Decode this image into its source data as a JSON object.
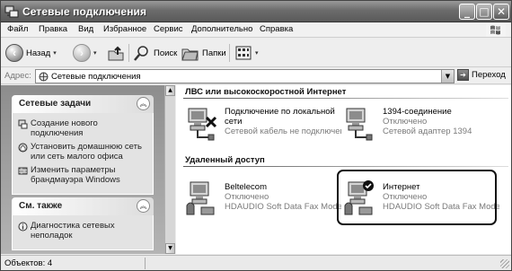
{
  "window": {
    "title": "Сетевые подключения",
    "controls": {
      "minimize": "_",
      "maximize": "□",
      "close": "✕"
    }
  },
  "menu": [
    "Файл",
    "Правка",
    "Вид",
    "Избранное",
    "Сервис",
    "Дополнительно",
    "Справка"
  ],
  "toolbar": {
    "back_label": "Назад",
    "search_label": "Поиск",
    "folders_label": "Папки"
  },
  "address": {
    "label": "Адрес:",
    "value": "Сетевые подключения",
    "go_label": "Переход"
  },
  "left_pane": {
    "network_tasks": {
      "title": "Сетевые задачи",
      "items": [
        "Создание нового подключения",
        "Установить домашнюю сеть или сеть малого офиса",
        "Изменить параметры брандмауэра Windows"
      ]
    },
    "see_also": {
      "title": "См. также",
      "items": [
        "Диагностика сетевых неполадок"
      ]
    }
  },
  "groups": {
    "lan": {
      "title": "ЛВС или высокоскоростной Интернет",
      "items": [
        {
          "name": "Подключение по локальной сети",
          "status": "Сетевой кабель не подключен"
        },
        {
          "name": "1394-соединение",
          "status": "Отключено",
          "device": "Сетевой адаптер 1394"
        }
      ]
    },
    "dialup": {
      "title": "Удаленный доступ",
      "items": [
        {
          "name": "Beltelecom",
          "status": "Отключено",
          "device": "HDAUDIO Soft Data Fax Mode..."
        },
        {
          "name": "Интернет",
          "status": "Отключено",
          "device": "HDAUDIO Soft Data Fax Mode..."
        }
      ]
    }
  },
  "statusbar": {
    "text": "Объектов: 4"
  },
  "colors": {
    "title_bar": "#6c6c6c",
    "pane_bg": "#a0a0a0",
    "highlight_border": "#111111"
  }
}
